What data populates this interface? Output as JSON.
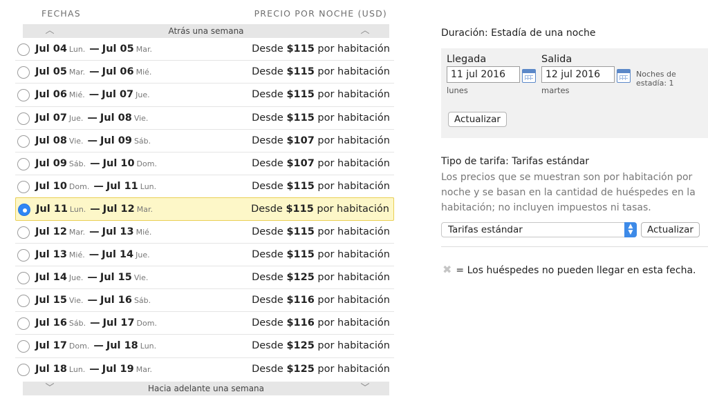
{
  "headers": {
    "dates": "FECHAS",
    "price": "PRECIO POR NOCHE (USD)"
  },
  "nav": {
    "back_week": "Atrás una semana",
    "forward_week": "Hacia adelante una semana"
  },
  "rows": [
    {
      "from": "Jul 04",
      "from_day": "Lun.",
      "to": "Jul 05",
      "to_day": "Mar.",
      "prefix": "Desde",
      "amount": "$115",
      "suffix": "por habitación",
      "selected": false
    },
    {
      "from": "Jul 05",
      "from_day": "Mar.",
      "to": "Jul 06",
      "to_day": "Mié.",
      "prefix": "Desde",
      "amount": "$115",
      "suffix": "por habitación",
      "selected": false
    },
    {
      "from": "Jul 06",
      "from_day": "Mié.",
      "to": "Jul 07",
      "to_day": "Jue.",
      "prefix": "Desde",
      "amount": "$115",
      "suffix": "por habitación",
      "selected": false
    },
    {
      "from": "Jul 07",
      "from_day": "Jue.",
      "to": "Jul 08",
      "to_day": "Vie.",
      "prefix": "Desde",
      "amount": "$115",
      "suffix": "por habitación",
      "selected": false
    },
    {
      "from": "Jul 08",
      "from_day": "Vie.",
      "to": "Jul 09",
      "to_day": "Sáb.",
      "prefix": "Desde",
      "amount": "$107",
      "suffix": "por habitación",
      "selected": false
    },
    {
      "from": "Jul 09",
      "from_day": "Sáb.",
      "to": "Jul 10",
      "to_day": "Dom.",
      "prefix": "Desde",
      "amount": "$107",
      "suffix": "por habitación",
      "selected": false
    },
    {
      "from": "Jul 10",
      "from_day": "Dom.",
      "to": "Jul 11",
      "to_day": "Lun.",
      "prefix": "Desde",
      "amount": "$115",
      "suffix": "por habitación",
      "selected": false
    },
    {
      "from": "Jul 11",
      "from_day": "Lun.",
      "to": "Jul 12",
      "to_day": "Mar.",
      "prefix": "Desde",
      "amount": "$115",
      "suffix": "por habitación",
      "selected": true
    },
    {
      "from": "Jul 12",
      "from_day": "Mar.",
      "to": "Jul 13",
      "to_day": "Mié.",
      "prefix": "Desde",
      "amount": "$115",
      "suffix": "por habitación",
      "selected": false
    },
    {
      "from": "Jul 13",
      "from_day": "Mié.",
      "to": "Jul 14",
      "to_day": "Jue.",
      "prefix": "Desde",
      "amount": "$115",
      "suffix": "por habitación",
      "selected": false
    },
    {
      "from": "Jul 14",
      "from_day": "Jue.",
      "to": "Jul 15",
      "to_day": "Vie.",
      "prefix": "Desde",
      "amount": "$125",
      "suffix": "por habitación",
      "selected": false
    },
    {
      "from": "Jul 15",
      "from_day": "Vie.",
      "to": "Jul 16",
      "to_day": "Sáb.",
      "prefix": "Desde",
      "amount": "$116",
      "suffix": "por habitación",
      "selected": false
    },
    {
      "from": "Jul 16",
      "from_day": "Sáb.",
      "to": "Jul 17",
      "to_day": "Dom.",
      "prefix": "Desde",
      "amount": "$116",
      "suffix": "por habitación",
      "selected": false
    },
    {
      "from": "Jul 17",
      "from_day": "Dom.",
      "to": "Jul 18",
      "to_day": "Lun.",
      "prefix": "Desde",
      "amount": "$125",
      "suffix": "por habitación",
      "selected": false
    },
    {
      "from": "Jul 18",
      "from_day": "Lun.",
      "to": "Jul 19",
      "to_day": "Mar.",
      "prefix": "Desde",
      "amount": "$125",
      "suffix": "por habitación",
      "selected": false
    }
  ],
  "right": {
    "duration": "Duración: Estadía de una noche",
    "arrival_label": "Llegada",
    "arrival_value": "11 jul 2016",
    "arrival_day": "lunes",
    "departure_label": "Salida",
    "departure_value": "12 jul 2016",
    "departure_day": "martes",
    "nights_label": "Noches de estadía: 1",
    "update_label": "Actualizar",
    "rate_type": "Tipo de tarifa: Tarifas estándar",
    "rate_description": "Los precios que se muestran son por habitación por noche y se basan en la cantidad de huéspedes en la habitación; no incluyen impuestos ni tasas.",
    "rate_select_value": "Tarifas estándar",
    "rate_update_label": "Actualizar",
    "legend_text": "= Los huéspedes no pueden llegar en esta fecha."
  },
  "colors": {
    "selected_bg": "#fdf7c8",
    "selected_border": "#e9cf53",
    "radio_selected": "#2f86f5",
    "select_arrow": "#3d8ae8"
  }
}
